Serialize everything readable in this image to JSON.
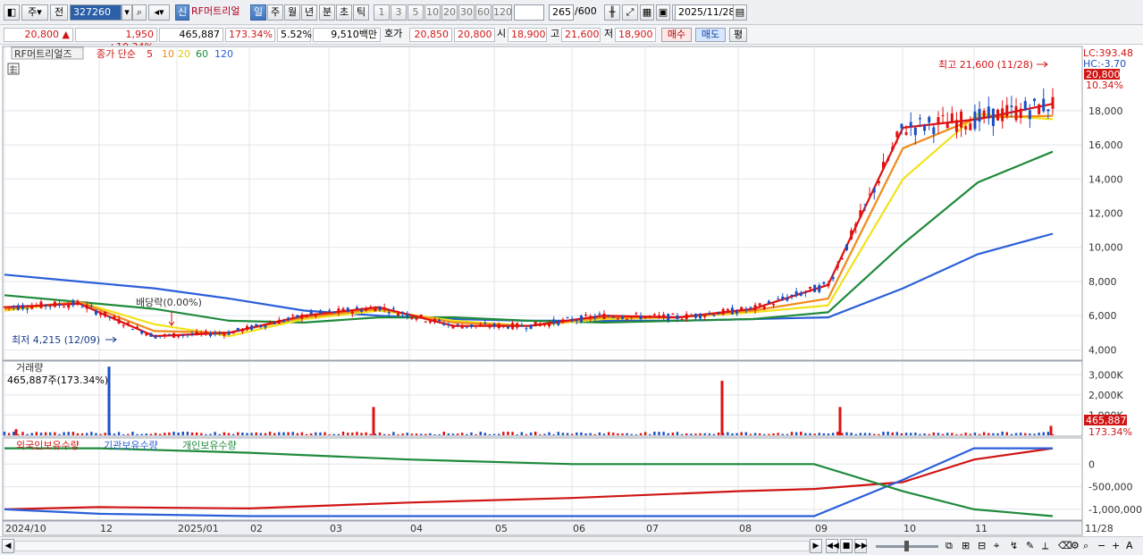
{
  "toolbar": {
    "market": "주",
    "prev": "전",
    "code": "327260",
    "credit_badge": "신",
    "stock_name": "RF머트리얼",
    "periods": [
      "일",
      "주",
      "월",
      "년",
      "분",
      "초",
      "틱"
    ],
    "active_period": "일",
    "intervals": [
      "1",
      "3",
      "5",
      "10",
      "20",
      "30",
      "60",
      "120"
    ],
    "count": "265",
    "count_max": "/600",
    "date": "2025/11/28"
  },
  "info": {
    "price": "20,800",
    "arrow": "▲",
    "change": "1,950",
    "change_pct": "+10.34%",
    "volume": "465,887",
    "volume_ratio": "173.34%",
    "turnover": "5.52%",
    "amount": "9,510백만",
    "quote_label": "호가",
    "ask": "20,850",
    "bid": "20,800",
    "open_label": "시",
    "open": "18,900",
    "high_label": "고",
    "high": "21,600",
    "low_label": "저",
    "low": "18,900",
    "buy": "매수",
    "sell": "매도",
    "avg": "평"
  },
  "price_pane": {
    "title_name": "RF머트리얼즈",
    "legend_prefix": "종가 단순",
    "ma_labels": [
      "5",
      "10",
      "20",
      "60",
      "120"
    ],
    "ma_colors": [
      "#e01010",
      "#f08a1a",
      "#f2e21a",
      "#1f8a3c",
      "#2b5fd8"
    ],
    "lc": "LC:393.48",
    "hc": "HC:-3.70",
    "last_price": "20,800",
    "last_pct": "10.34%",
    "high_annot": "최고 21,600 (11/28)",
    "low_annot": "최저 4,215 (12/09)",
    "dividend_annot": "배당락(0.00%)",
    "y_ticks": [
      "18,000",
      "16,000",
      "14,000",
      "12,000",
      "10,000",
      "8,000",
      "6,000",
      "4,000"
    ]
  },
  "volume_pane": {
    "title": "거래량",
    "value": "465,887주(173.34%)",
    "y_ticks": [
      "3,000K",
      "2,000K",
      "1,000K"
    ],
    "last_value": "465,887",
    "last_pct": "173.34%"
  },
  "holdings_pane": {
    "legend": [
      "외국인보유수량",
      "기관보유수량",
      "개인보유수량"
    ],
    "legend_colors": [
      "#d01515",
      "#2b5fd8",
      "#1f8a3c"
    ],
    "y_ticks": [
      "0",
      "-500,000",
      "-1,000,000"
    ]
  },
  "x_axis": [
    "2024/10",
    "12",
    "2025/01",
    "02",
    "03",
    "04",
    "05",
    "06",
    "07",
    "08",
    "09",
    "10",
    "11",
    "11/28"
  ],
  "chart_data": [
    {
      "type": "line",
      "title": "RF머트리얼즈",
      "x": [
        "2024/10",
        "2024/11",
        "2024/12",
        "2025/01",
        "2025/02",
        "2025/03",
        "2025/04",
        "2025/05",
        "2025/06",
        "2025/07",
        "2025/08",
        "2025/09",
        "2025/10",
        "2025/11",
        "2025/11/28"
      ],
      "series": [
        {
          "name": "5",
          "values": [
            6500,
            6700,
            4800,
            5000,
            6000,
            6500,
            5400,
            5400,
            6000,
            5900,
            6400,
            7800,
            17000,
            17500,
            18400
          ]
        },
        {
          "name": "10",
          "values": [
            6400,
            6800,
            5100,
            5000,
            5900,
            6400,
            5600,
            5400,
            5900,
            5900,
            6300,
            7000,
            15800,
            17600,
            17700
          ]
        },
        {
          "name": "20",
          "values": [
            6300,
            6800,
            5500,
            4800,
            5800,
            6300,
            5700,
            5400,
            5800,
            5900,
            6200,
            6600,
            14000,
            17800,
            17500
          ]
        },
        {
          "name": "60",
          "values": [
            7200,
            6800,
            6400,
            5700,
            5600,
            5900,
            5900,
            5700,
            5600,
            5700,
            5800,
            6200,
            10200,
            13800,
            15600
          ]
        },
        {
          "name": "120",
          "values": [
            8400,
            8000,
            7600,
            7000,
            6300,
            6000,
            5800,
            5700,
            5700,
            5700,
            5800,
            5900,
            7600,
            9600,
            10800
          ]
        }
      ],
      "ylim": [
        3500,
        21600
      ],
      "annotations": [
        "최고 21,600 (11/28)",
        "최저 4,215 (12/09)",
        "배당락(0.00%)"
      ]
    },
    {
      "type": "bar",
      "title": "거래량",
      "categories": [
        "2024/10",
        "2024/12 spike",
        "2025/03",
        "2025/07 spike",
        "2025/09",
        "2025/11/28"
      ],
      "values": [
        300,
        3400,
        1400,
        2700,
        1400,
        466
      ],
      "ylim": [
        0,
        3500
      ]
    },
    {
      "type": "line",
      "title": "보유수량",
      "x": [
        "2024/10",
        "2024/12",
        "2025/02",
        "2025/04",
        "2025/06",
        "2025/08",
        "2025/09",
        "2025/10",
        "2025/11",
        "2025/11/28"
      ],
      "series": [
        {
          "name": "외국인보유수량",
          "values": [
            -1000000,
            -950000,
            -980000,
            -850000,
            -750000,
            -600000,
            -550000,
            -400000,
            100000,
            350000
          ]
        },
        {
          "name": "기관보유수량",
          "values": [
            -1000000,
            -1100000,
            -1150000,
            -1150000,
            -1150000,
            -1150000,
            -1150000,
            -350000,
            350000,
            350000
          ]
        },
        {
          "name": "개인보유수량",
          "values": [
            350000,
            350000,
            250000,
            100000,
            0,
            0,
            0,
            -600000,
            -1000000,
            -1150000
          ]
        }
      ],
      "ylim": [
        -1200000,
        500000
      ]
    }
  ]
}
